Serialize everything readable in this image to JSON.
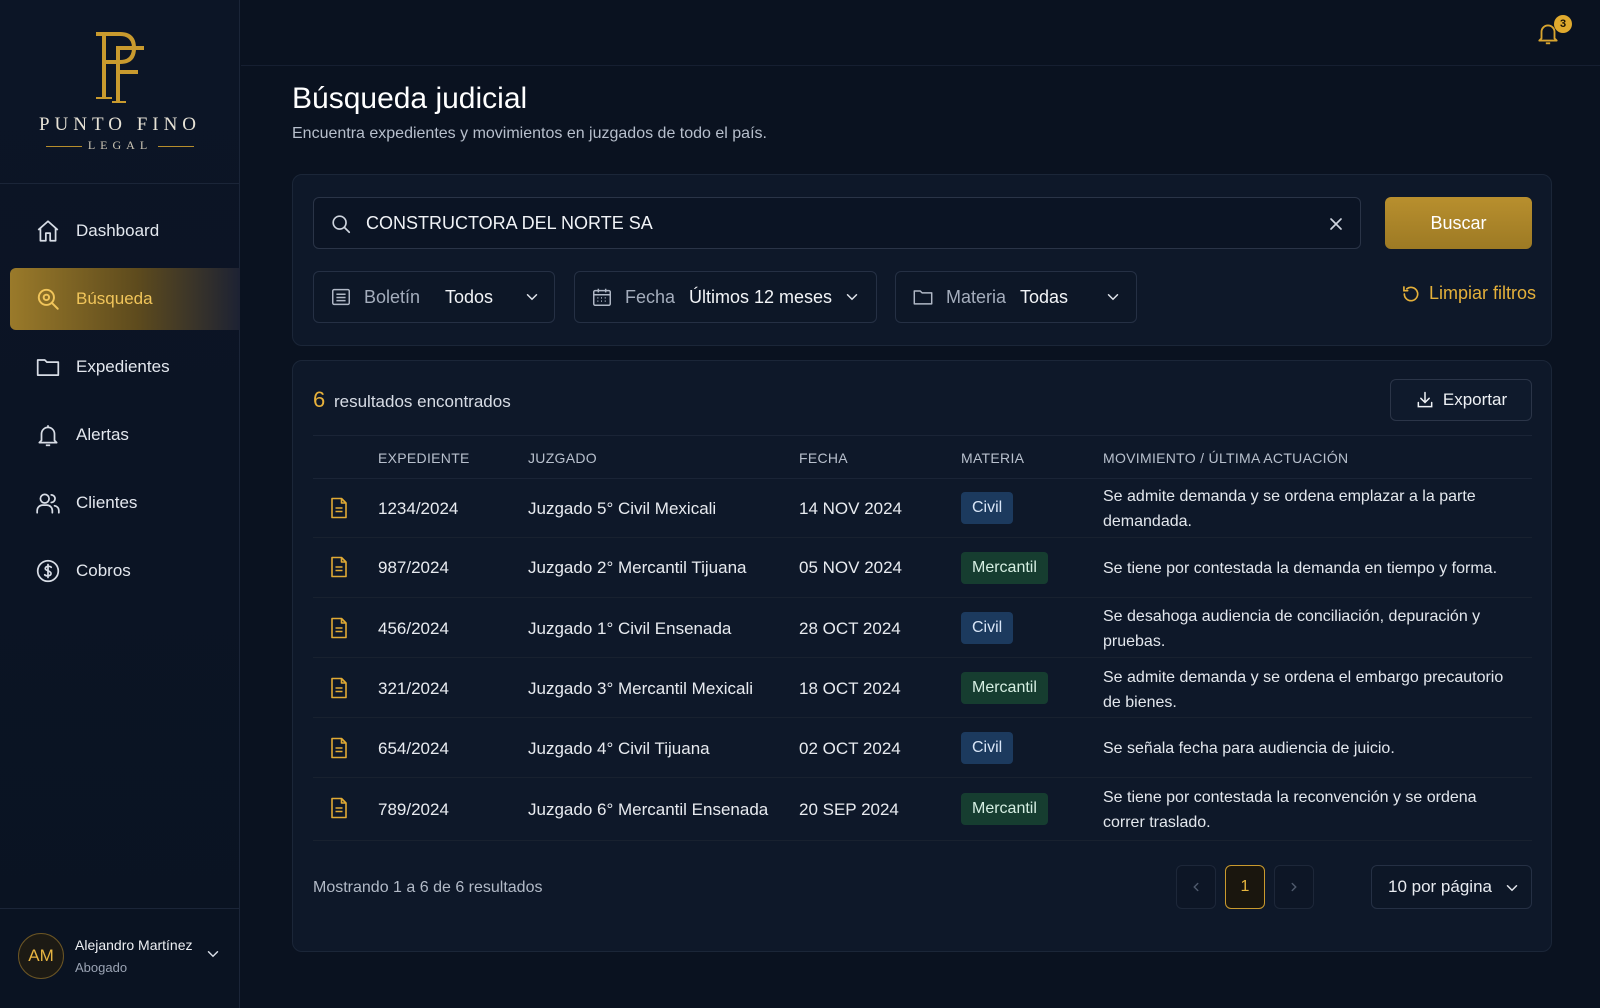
{
  "brand": {
    "name": "PUNTO FINO",
    "sub": "LEGAL",
    "accent": "#c99a2e"
  },
  "sidebar": {
    "items": [
      {
        "label": "Dashboard",
        "icon": "home-icon",
        "active": false
      },
      {
        "label": "Búsqueda",
        "icon": "search-doc-icon",
        "active": true
      },
      {
        "label": "Expedientes",
        "icon": "folder-icon",
        "active": false
      },
      {
        "label": "Alertas",
        "icon": "bell-icon",
        "active": false
      },
      {
        "label": "Clientes",
        "icon": "users-icon",
        "active": false
      },
      {
        "label": "Cobros",
        "icon": "dollar-icon",
        "active": false
      }
    ],
    "user": {
      "initials": "AM",
      "name": "Alejandro Martínez",
      "role": "Abogado"
    }
  },
  "topbar": {
    "notifications": "3"
  },
  "header": {
    "title": "Búsqueda judicial",
    "subtitle": "Encuentra expedientes y movimientos en juzgados de todo el país."
  },
  "search": {
    "value": "CONSTRUCTORA DEL NORTE SA",
    "button": "Buscar",
    "filters": [
      {
        "label": "Boletín",
        "value": "Todos",
        "icon": "list-icon"
      },
      {
        "label": "Fecha",
        "value": "Últimos 12 meses",
        "icon": "calendar-icon"
      },
      {
        "label": "Materia",
        "value": "Todas",
        "icon": "folder-icon"
      }
    ],
    "clear_filters": "Limpiar filtros"
  },
  "results": {
    "count": "6",
    "count_label": "resultados encontrados",
    "export": "Exportar",
    "columns": [
      "EXPEDIENTE",
      "JUZGADO",
      "FECHA",
      "MATERIA",
      "MOVIMIENTO / ÚLTIMA ACTUACIÓN"
    ],
    "rows": [
      {
        "expediente": "1234/2024",
        "juzgado": "Juzgado 5° Civil Mexicali",
        "fecha": "14 NOV 2024",
        "materia": "Civil",
        "movimiento": "Se admite demanda y se ordena emplazar a la parte demandada."
      },
      {
        "expediente": "987/2024",
        "juzgado": "Juzgado 2° Mercantil Tijuana",
        "fecha": "05 NOV 2024",
        "materia": "Mercantil",
        "movimiento": "Se tiene por contestada la demanda en tiempo y forma."
      },
      {
        "expediente": "456/2024",
        "juzgado": "Juzgado 1° Civil Ensenada",
        "fecha": "28 OCT 2024",
        "materia": "Civil",
        "movimiento": "Se desahoga audiencia de conciliación, depuración y pruebas."
      },
      {
        "expediente": "321/2024",
        "juzgado": "Juzgado 3° Mercantil Mexicali",
        "fecha": "18 OCT 2024",
        "materia": "Mercantil",
        "movimiento": "Se admite demanda y se ordena el embargo precautorio de bienes."
      },
      {
        "expediente": "654/2024",
        "juzgado": "Juzgado 4° Civil Tijuana",
        "fecha": "02 OCT 2024",
        "materia": "Civil",
        "movimiento": "Se señala fecha para audiencia de juicio."
      },
      {
        "expediente": "789/2024",
        "juzgado": "Juzgado 6° Mercantil Ensenada",
        "fecha": "20 SEP 2024",
        "materia": "Mercantil",
        "movimiento": "Se tiene por contestada la reconvención y se ordena correr traslado."
      }
    ],
    "showing": "Mostrando 1 a 6 de 6 resultados",
    "current_page": "1",
    "per_page": "10 por página"
  }
}
